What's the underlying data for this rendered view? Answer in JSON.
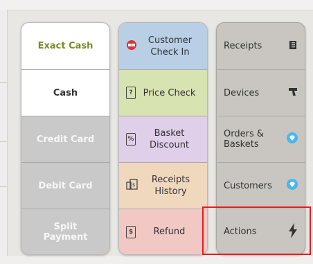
{
  "colors": {
    "exact_cash_text": "#7a8a2a",
    "cash_text": "#333333",
    "gray_button": "#c9c9c9",
    "blue_tile": "#b9cfe6",
    "green_tile": "#d7e3b0",
    "lavender_tile": "#dfcfe8",
    "peach_tile": "#f0d8bf",
    "pink_tile": "#f1c8c3",
    "diamond_blue": "#47b7ee",
    "highlight_red": "#e41d1d"
  },
  "payments": [
    {
      "label": "Exact Cash"
    },
    {
      "label": "Cash"
    },
    {
      "label": "Credit Card"
    },
    {
      "label": "Debit Card"
    },
    {
      "label": "Split Payment"
    }
  ],
  "mid_actions": [
    {
      "label": "Customer Check In",
      "icon": "coupon-badge-icon"
    },
    {
      "label": "Price Check",
      "icon": "price-tag-icon"
    },
    {
      "label": "Basket Discount",
      "icon": "discount-icon"
    },
    {
      "label": "Receipts History",
      "icon": "receipt-icon"
    },
    {
      "label": "Refund",
      "icon": "refund-icon"
    }
  ],
  "right_actions": [
    {
      "label": "Receipts",
      "icon": "book-icon"
    },
    {
      "label": "Devices",
      "icon": "scanner-icon"
    },
    {
      "label": "Orders & Baskets",
      "icon": "diamond-icon"
    },
    {
      "label": "Customers",
      "icon": "diamond-icon"
    },
    {
      "label": "Actions",
      "icon": "bolt-icon"
    }
  ]
}
